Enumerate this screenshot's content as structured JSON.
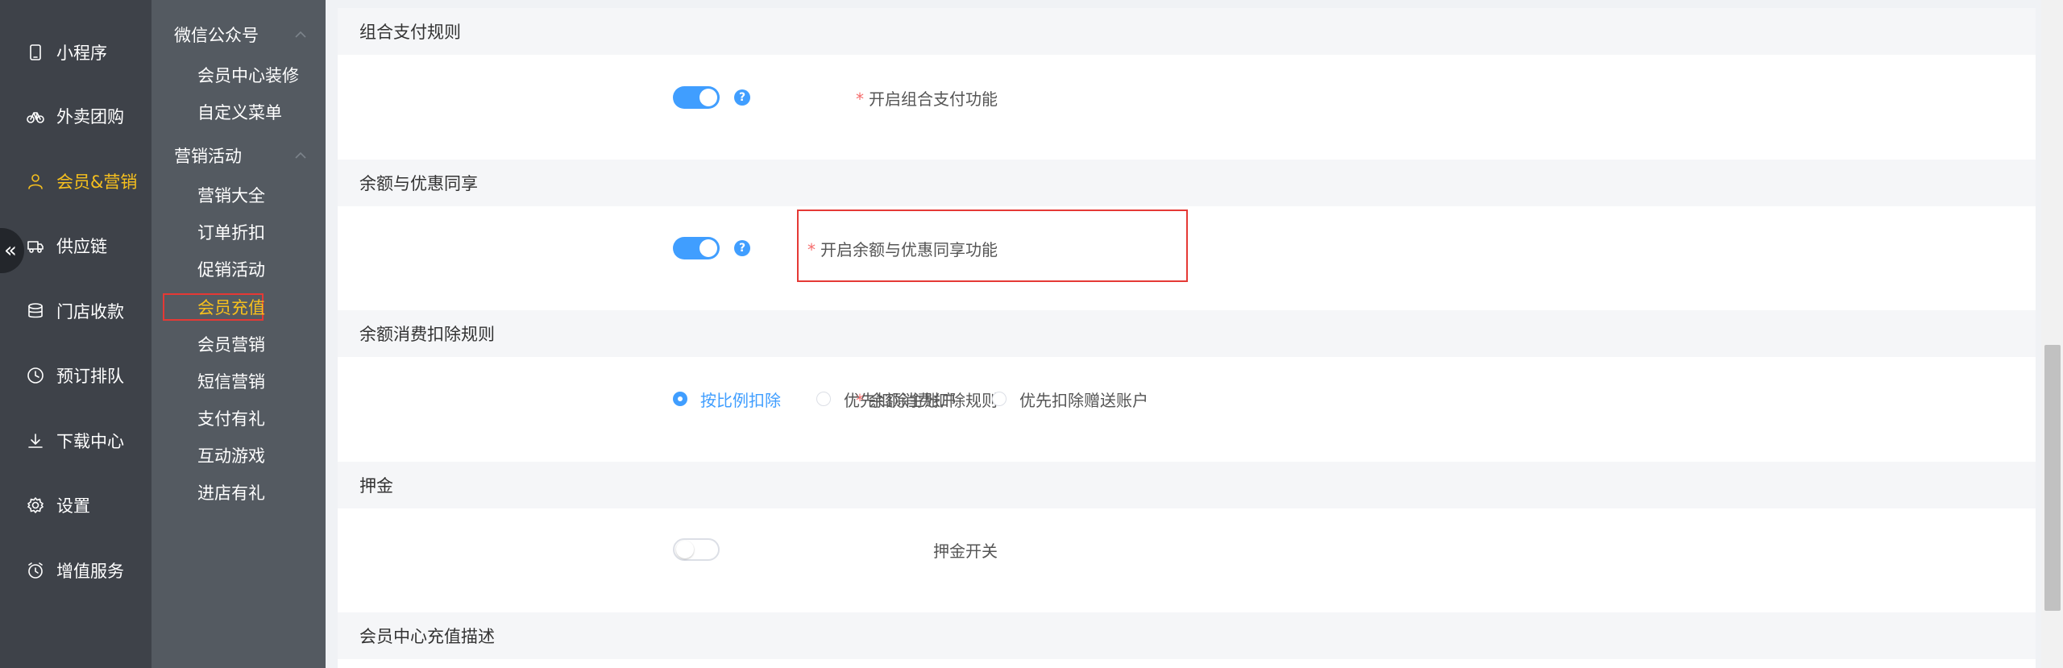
{
  "sidebar": {
    "items": [
      {
        "label": "小程序",
        "icon": "phone-icon",
        "active": false
      },
      {
        "label": "外卖团购",
        "icon": "bicycle-icon",
        "active": false
      },
      {
        "label": "会员&营销",
        "icon": "user-icon",
        "active": true
      },
      {
        "label": "供应链",
        "icon": "truck-icon",
        "active": false
      },
      {
        "label": "门店收款",
        "icon": "coins-icon",
        "active": false
      },
      {
        "label": "预订排队",
        "icon": "clock-icon",
        "active": false
      },
      {
        "label": "下载中心",
        "icon": "download-icon",
        "active": false
      },
      {
        "label": "设置",
        "icon": "gear-icon",
        "active": false
      },
      {
        "label": "增值服务",
        "icon": "alarm-icon",
        "active": false
      }
    ],
    "collapse_glyph": "«",
    "active_color": "#f7c01d"
  },
  "subnav": {
    "groups": [
      {
        "title": "微信公众号",
        "items": [
          "会员中心装修",
          "自定义菜单"
        ]
      },
      {
        "title": "营销活动",
        "items": [
          "营销大全",
          "订单折扣",
          "促销活动",
          "会员充值",
          "会员营销",
          "短信营销",
          "支付有礼",
          "互动游戏",
          "进店有礼"
        ]
      }
    ],
    "active_item": "会员充值"
  },
  "content": {
    "sections": {
      "combined_payment": {
        "header": "组合支付规则",
        "label": "开启组合支付功能",
        "enabled": true
      },
      "balance_discount": {
        "header": "余额与优惠同享",
        "label": "开启余额与优惠同享功能",
        "enabled": true
      },
      "balance_deduction": {
        "header": "余额消费扣除规则",
        "label": "余额消费扣除规则",
        "options": [
          "按比例扣除",
          "优先扣除主账户",
          "优先扣除赠送账户"
        ],
        "selected": "按比例扣除"
      },
      "deposit": {
        "header": "押金",
        "label": "押金开关",
        "enabled": false
      },
      "recharge_desc": {
        "header": "会员中心充值描述"
      }
    },
    "required_mark": "*",
    "help_glyph": "?",
    "accent_color": "#409eff"
  }
}
